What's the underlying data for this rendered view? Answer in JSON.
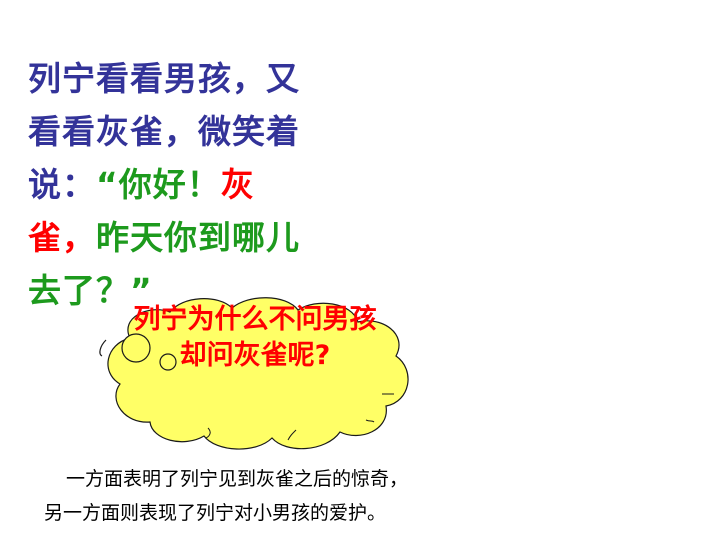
{
  "main_text": {
    "line1": "列宁看看男孩，又",
    "line2": "看看灰雀，微笑着",
    "line3_prefix": "说：",
    "line3_quote": "“你好！",
    "line3_red": "灰",
    "line4_red": "雀，",
    "line4_green": "昨天你到哪儿",
    "line5": "去了？”"
  },
  "question": {
    "line1": "列宁为什么不问男孩",
    "line2": "却问灰雀呢?"
  },
  "explanation": {
    "line1": "一方面表明了列宁见到灰雀之后的惊奇，",
    "line2": "另一方面则表现了列宁对小男孩的爱护。"
  },
  "colors": {
    "navy": "#333399",
    "green": "#1d9a1d",
    "red": "#ff0000",
    "cloud_fill": "#ffff66"
  }
}
